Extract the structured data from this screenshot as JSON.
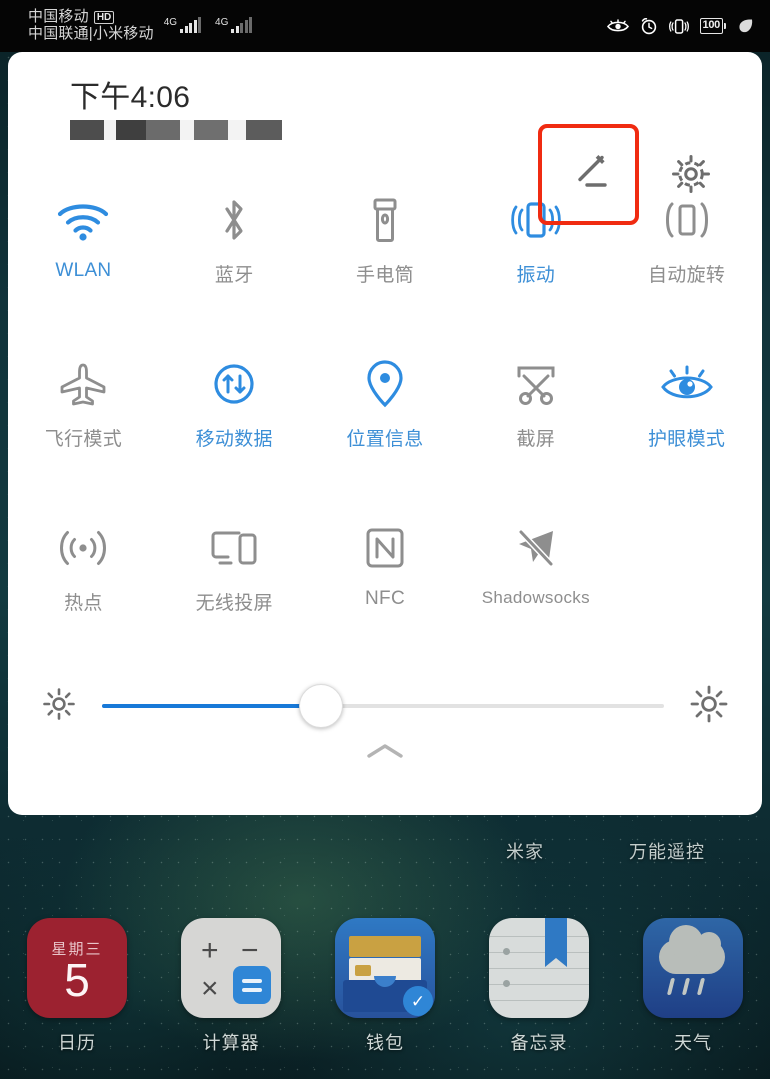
{
  "statusbar": {
    "carrier_primary": "中国移动",
    "carrier_hd_badge": "HD",
    "carrier_secondary": "中国联通|小米移动",
    "network_type_1": "4G",
    "network_type_2": "4G",
    "battery_percent": "100",
    "icons": [
      "eye-comfort-icon",
      "alarm-clock-icon",
      "vibrate-icon",
      "battery-icon",
      "leaf-power-saving-icon"
    ]
  },
  "quick_settings": {
    "time": "下午4:06",
    "date_redacted": true,
    "edit_button_label": "edit-icon",
    "settings_button_label": "gear-icon",
    "highlight_color": "#f02b11",
    "active_color": "#3d8fd6",
    "inactive_color": "#8e8e8e",
    "tiles": [
      {
        "label": "WLAN",
        "icon": "wifi-icon",
        "active": true
      },
      {
        "label": "蓝牙",
        "icon": "bluetooth-icon",
        "active": false
      },
      {
        "label": "手电筒",
        "icon": "flashlight-icon",
        "active": false
      },
      {
        "label": "振动",
        "icon": "vibrate-icon",
        "active": true
      },
      {
        "label": "自动旋转",
        "icon": "auto-rotate-icon",
        "active": false
      },
      {
        "label": "飞行模式",
        "icon": "airplane-icon",
        "active": false
      },
      {
        "label": "移动数据",
        "icon": "mobile-data-icon",
        "active": true
      },
      {
        "label": "位置信息",
        "icon": "location-pin-icon",
        "active": true
      },
      {
        "label": "截屏",
        "icon": "screenshot-scissors-icon",
        "active": false
      },
      {
        "label": "护眼模式",
        "icon": "eye-comfort-icon",
        "active": true
      },
      {
        "label": "热点",
        "icon": "hotspot-icon",
        "active": false
      },
      {
        "label": "无线投屏",
        "icon": "cast-screen-icon",
        "active": false
      },
      {
        "label": "NFC",
        "icon": "nfc-icon",
        "active": false
      },
      {
        "label": "Shadowsocks",
        "icon": "paper-plane-off-icon",
        "active": false
      }
    ],
    "brightness": {
      "value_percent": 39,
      "low_icon": "brightness-low-icon",
      "high_icon": "brightness-high-icon",
      "fill_color": "#1879d8"
    },
    "collapse_handle_icon": "chevron-up-icon"
  },
  "home_screen": {
    "widget_labels": [
      {
        "label": "米家"
      },
      {
        "label": "万能遥控"
      }
    ],
    "dock_apps": [
      {
        "label": "日历",
        "icon": "calendar-icon",
        "weekday": "星期三",
        "day": "5"
      },
      {
        "label": "计算器",
        "icon": "calculator-icon"
      },
      {
        "label": "钱包",
        "icon": "wallet-icon"
      },
      {
        "label": "备忘录",
        "icon": "memo-icon"
      },
      {
        "label": "天气",
        "icon": "weather-rain-icon"
      }
    ]
  }
}
